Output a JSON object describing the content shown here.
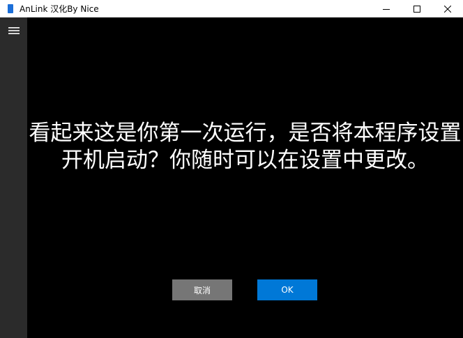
{
  "window": {
    "title": "AnLink 汉化By Nice",
    "controls": {
      "minimize_icon": "minimize-icon",
      "maximize_icon": "maximize-icon",
      "close_icon": "close-icon"
    }
  },
  "sidebar": {
    "menu_icon": "hamburger-menu-icon"
  },
  "dialog": {
    "message_line1": "看起来这是你第一次运行，是否将本程序设置",
    "message_line2": "开机启动？你随时可以在设置中更改。",
    "cancel_label": "取消",
    "ok_label": "OK"
  },
  "colors": {
    "background": "#000000",
    "rail": "#2b2b2b",
    "cancel_button": "#767676",
    "ok_button": "#0078d7",
    "app_icon": "#1c6fd8"
  }
}
